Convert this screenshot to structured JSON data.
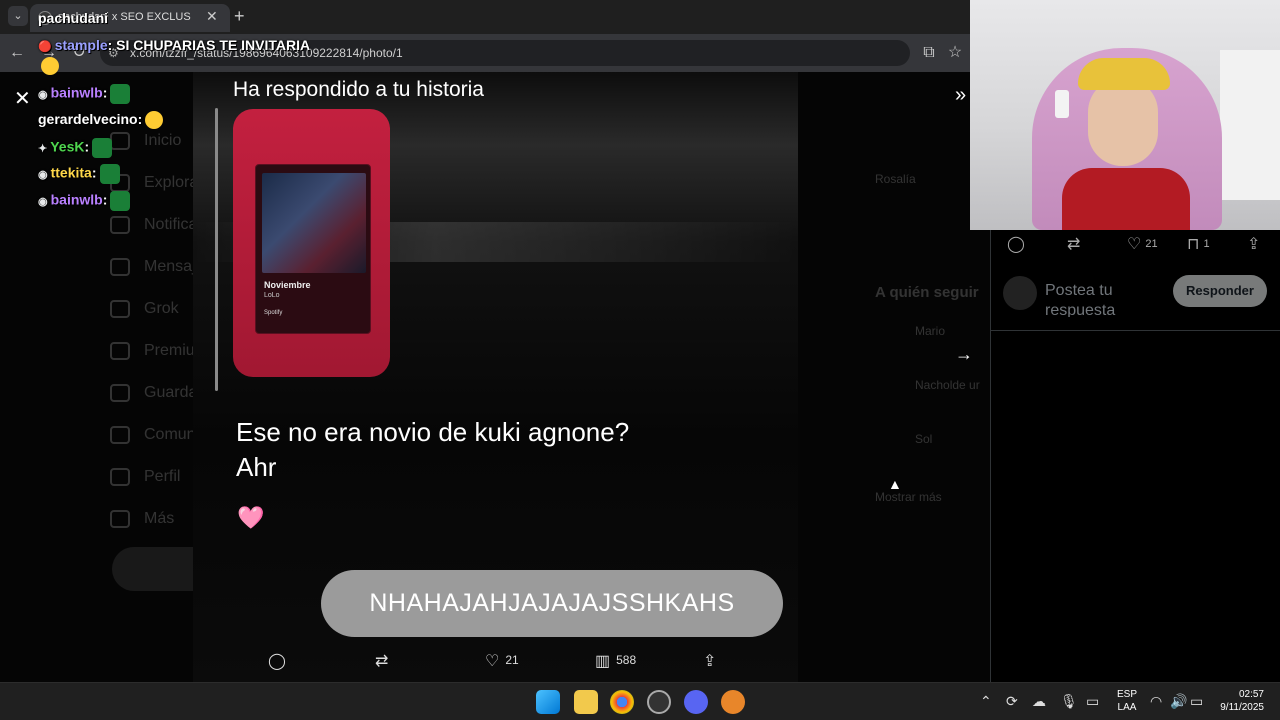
{
  "browser": {
    "tab_title": "pachudani x SEO EXCLUS",
    "new_tab_symbol": "+",
    "url": "x.com/tzzff_/status/1986964063109222814/photo/1"
  },
  "photo": {
    "replied_text": "Ha respondido a tu historia",
    "story": {
      "song": "Noviembre",
      "artist": "LoLo",
      "service": "Spotify"
    },
    "message_line1": "Ese no era novio de kuki agnone?",
    "message_line2": "Ahr",
    "heart": "🩷",
    "caption": "NHAHAJAHJAJAJAJSSHKAHS"
  },
  "photo_actions": {
    "likes": "21",
    "views": "588"
  },
  "dim_sidebar": [
    "Inicio",
    "Explorar",
    "Notificaciones",
    "Mensajes",
    "Grok",
    "Premium",
    "Guardados",
    "Comunidades",
    "Perfil",
    "Más"
  ],
  "dim_right": {
    "header": "Rosalía",
    "who_to_follow": "A quién seguir",
    "users": [
      "Mario",
      "Nacholde ur",
      "Sol"
    ],
    "show_more": "Mostrar más"
  },
  "right_panel": {
    "likes": "21",
    "bookmarks": "1",
    "reply_placeholder": "Postea tu respuesta",
    "reply_button": "Responder"
  },
  "chat": [
    {
      "user": "stample",
      "color": "#9aa0ff",
      "message": ": SI CHUPARIAS TE INVITARIA"
    },
    {
      "user": "bainwlb",
      "color": "#b980ff",
      "message": ":"
    },
    {
      "user": "gerardelvecino",
      "color": "#ffffff",
      "message": ":"
    },
    {
      "user": "YesK",
      "color": "#4fd64f",
      "message": ":"
    },
    {
      "user": "ttekita",
      "color": "#ffd84a",
      "message": ":"
    },
    {
      "user": "bainwlb",
      "color": "#b980ff",
      "message": ":"
    }
  ],
  "chat_overlay_user": "pachudani",
  "taskbar": {
    "lang_1": "ESP",
    "lang_2": "LAA",
    "time": "02:57",
    "date": "9/11/2025"
  },
  "colors": {
    "reply_button": "#787a7a",
    "story_card": "#c3203f",
    "caption_bg": "#9b9b9b"
  }
}
